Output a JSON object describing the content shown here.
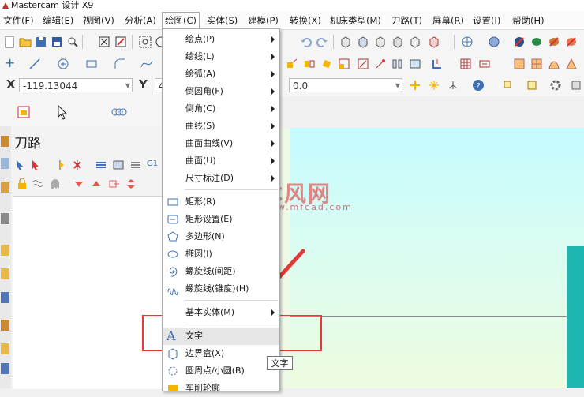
{
  "window": {
    "title": "Mastercam 设计 X9"
  },
  "menubar": {
    "items": [
      "文件(F)",
      "编辑(E)",
      "视图(V)",
      "分析(A)",
      "绘图(C)",
      "实体(S)",
      "建模(P)",
      "转换(X)",
      "机床类型(M)",
      "刀路(T)",
      "屏幕(R)",
      "设置(I)",
      "帮助(H)"
    ],
    "active_index": 4
  },
  "coords": {
    "x_label": "X",
    "x_value": "-119.13044",
    "y_label": "Y",
    "y_value": "4",
    "z_value": "0.0"
  },
  "panel": {
    "title": "刀路"
  },
  "dropdown": {
    "items": [
      {
        "label": "绘点(P)",
        "submenu": true,
        "icon": ""
      },
      {
        "label": "绘线(L)",
        "submenu": true,
        "icon": ""
      },
      {
        "label": "绘弧(A)",
        "submenu": true,
        "icon": ""
      },
      {
        "label": "倒圆角(F)",
        "submenu": true,
        "icon": ""
      },
      {
        "label": "倒角(C)",
        "submenu": true,
        "icon": ""
      },
      {
        "label": "曲线(S)",
        "submenu": true,
        "icon": ""
      },
      {
        "label": "曲面曲线(V)",
        "submenu": true,
        "icon": ""
      },
      {
        "label": "曲面(U)",
        "submenu": true,
        "icon": ""
      },
      {
        "label": "尺寸标注(D)",
        "submenu": true,
        "icon": ""
      },
      {
        "label": "矩形(R)",
        "submenu": false,
        "icon": "rectangle-icon"
      },
      {
        "label": "矩形设置(E)",
        "submenu": false,
        "icon": "rectangle-settings-icon"
      },
      {
        "label": "多边形(N)",
        "submenu": false,
        "icon": "polygon-icon"
      },
      {
        "label": "椭圆(I)",
        "submenu": false,
        "icon": "ellipse-icon"
      },
      {
        "label": "螺旋线(间距)",
        "submenu": false,
        "icon": "spiral-icon"
      },
      {
        "label": "螺旋线(锥度)(H)",
        "submenu": false,
        "icon": "helix-icon"
      },
      {
        "label": "基本实体(M)",
        "submenu": true,
        "icon": ""
      },
      {
        "label": "文字",
        "submenu": false,
        "icon": "text-icon"
      },
      {
        "label": "边界盒(X)",
        "submenu": false,
        "icon": "bounding-box-icon"
      },
      {
        "label": "圆周点/小圆(B)",
        "submenu": false,
        "icon": "bolt-circle-icon"
      },
      {
        "label": "车削轮廓",
        "submenu": false,
        "icon": "turn-profile-icon"
      }
    ],
    "highlight_index": 16
  },
  "tooltip": {
    "text": "文字"
  },
  "watermark": {
    "brand": "沐风网",
    "url": "www.mfcad.com"
  },
  "colors": {
    "annotation_red": "#e53935",
    "highlight": "#e6e6e6",
    "gfx_top": "#c5fbff",
    "gfx_bottom": "#eefce0",
    "model_teal": "#1fb5b0"
  }
}
